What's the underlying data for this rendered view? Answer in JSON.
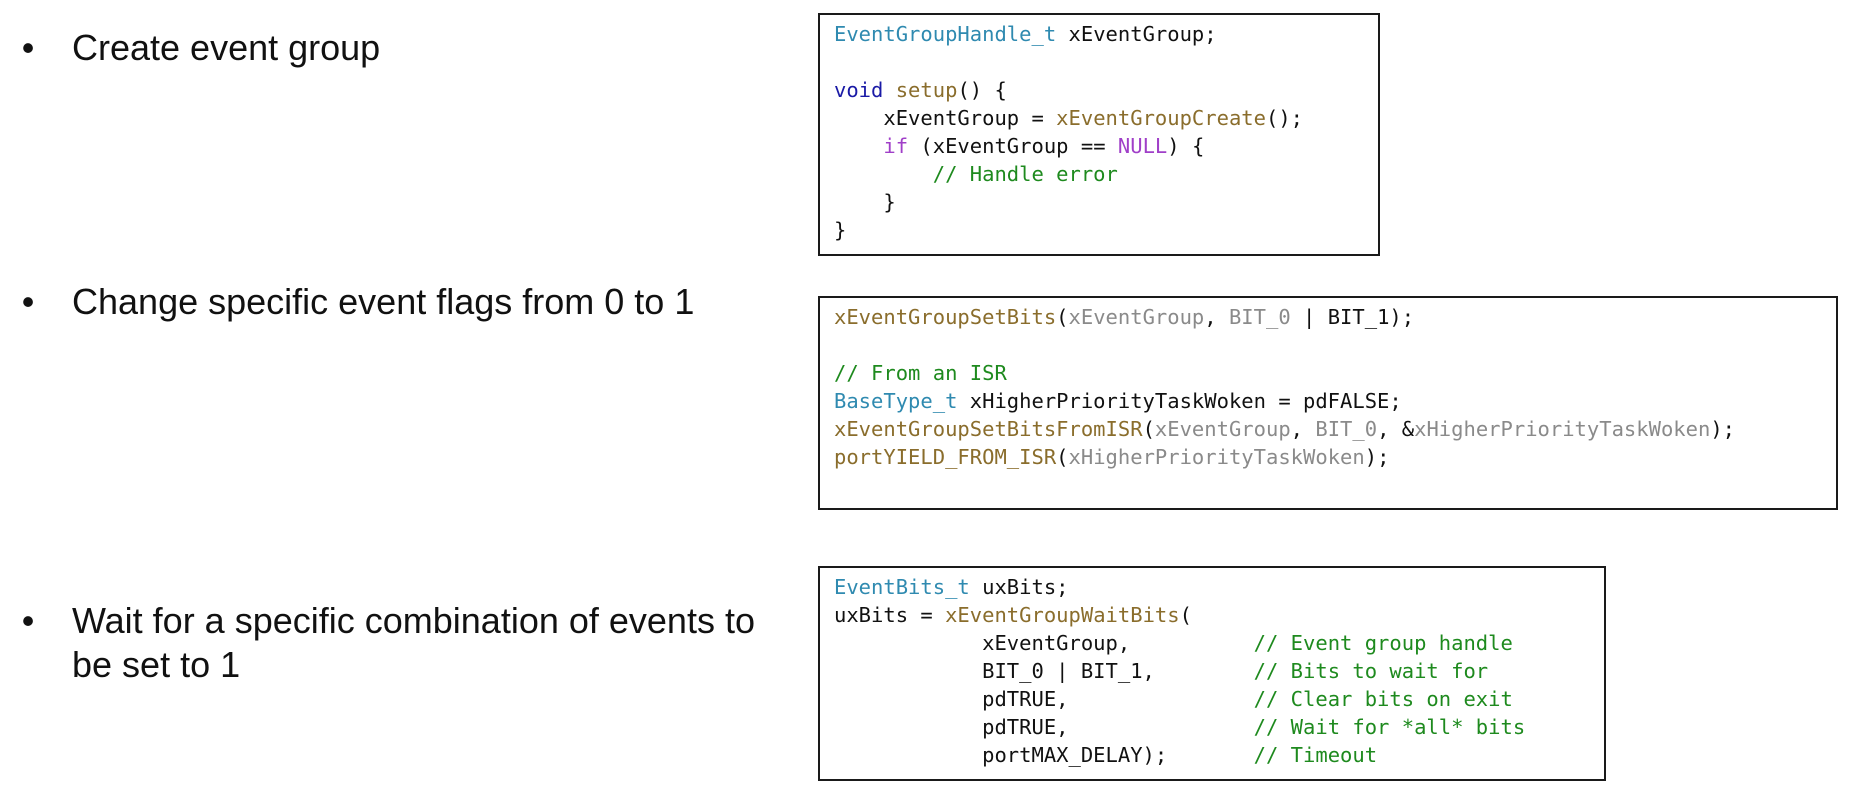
{
  "bullets": [
    {
      "id": "create",
      "lines": [
        "Create event group"
      ]
    },
    {
      "id": "set",
      "lines": [
        "Change specific event flags from 0 to 1"
      ]
    },
    {
      "id": "wait",
      "lines": [
        "Wait for a specific combination of events to",
        "be set to 1"
      ]
    }
  ],
  "bullet_glyph": "•",
  "code_blocks": [
    {
      "id": "create-code",
      "lines": [
        [
          [
            "type",
            "EventGroupHandle_t"
          ],
          [
            "plain",
            " xEventGroup;"
          ]
        ],
        [],
        [
          [
            "kw",
            "void"
          ],
          [
            "plain",
            " "
          ],
          [
            "fn",
            "setup"
          ],
          [
            "plain",
            "() {"
          ]
        ],
        [
          [
            "plain",
            "    xEventGroup = "
          ],
          [
            "fn",
            "xEventGroupCreate"
          ],
          [
            "plain",
            "();"
          ]
        ],
        [
          [
            "plain",
            "    "
          ],
          [
            "kw2",
            "if"
          ],
          [
            "plain",
            " (xEventGroup == "
          ],
          [
            "kw2",
            "NULL"
          ],
          [
            "plain",
            ") {"
          ]
        ],
        [
          [
            "comment",
            "        // Handle error"
          ]
        ],
        [
          [
            "plain",
            "    }"
          ]
        ],
        [
          [
            "plain",
            "}"
          ]
        ]
      ]
    },
    {
      "id": "set-code",
      "lines": [
        [
          [
            "fn",
            "xEventGroupSetBits"
          ],
          [
            "plain",
            "("
          ],
          [
            "param",
            "xEventGroup"
          ],
          [
            "plain",
            ", "
          ],
          [
            "param",
            "BIT_0"
          ],
          [
            "plain",
            " | BIT_1);"
          ]
        ],
        [],
        [
          [
            "comment",
            "// From an ISR"
          ]
        ],
        [
          [
            "type",
            "BaseType_t"
          ],
          [
            "plain",
            " xHigherPriorityTaskWoken = pdFALSE;"
          ]
        ],
        [
          [
            "fn",
            "xEventGroupSetBitsFromISR"
          ],
          [
            "plain",
            "("
          ],
          [
            "param",
            "xEventGroup"
          ],
          [
            "plain",
            ", "
          ],
          [
            "param",
            "BIT_0"
          ],
          [
            "plain",
            ", &"
          ],
          [
            "param",
            "xHigherPriorityTaskWoken"
          ],
          [
            "plain",
            ");"
          ]
        ],
        [
          [
            "fn",
            "portYIELD_FROM_ISR"
          ],
          [
            "plain",
            "("
          ],
          [
            "param",
            "xHigherPriorityTaskWoken"
          ],
          [
            "plain",
            ");"
          ]
        ]
      ]
    },
    {
      "id": "wait-code",
      "lines": [
        [
          [
            "type",
            "EventBits_t"
          ],
          [
            "plain",
            " uxBits;"
          ]
        ],
        [
          [
            "plain",
            "uxBits = "
          ],
          [
            "fn",
            "xEventGroupWaitBits"
          ],
          [
            "plain",
            "("
          ]
        ],
        [
          [
            "plain",
            "            xEventGroup,          "
          ],
          [
            "comment",
            "// Event group handle"
          ]
        ],
        [
          [
            "plain",
            "            BIT_0 | BIT_1,        "
          ],
          [
            "comment",
            "// Bits to wait for"
          ]
        ],
        [
          [
            "plain",
            "            pdTRUE,               "
          ],
          [
            "comment",
            "// Clear bits on exit"
          ]
        ],
        [
          [
            "plain",
            "            pdTRUE,               "
          ],
          [
            "comment",
            "// Wait for *all* bits"
          ]
        ],
        [
          [
            "plain",
            "            portMAX_DELAY);       "
          ],
          [
            "comment",
            "// Timeout"
          ]
        ]
      ]
    }
  ],
  "colors": {
    "type": "#2f8ab0",
    "keyword": "#1a1aa6",
    "keyword_purple": "#a03fc8",
    "function": "#8a6d2c",
    "parameter": "#8a8a8a",
    "comment": "#1e8a1e",
    "plain": "#111111"
  }
}
